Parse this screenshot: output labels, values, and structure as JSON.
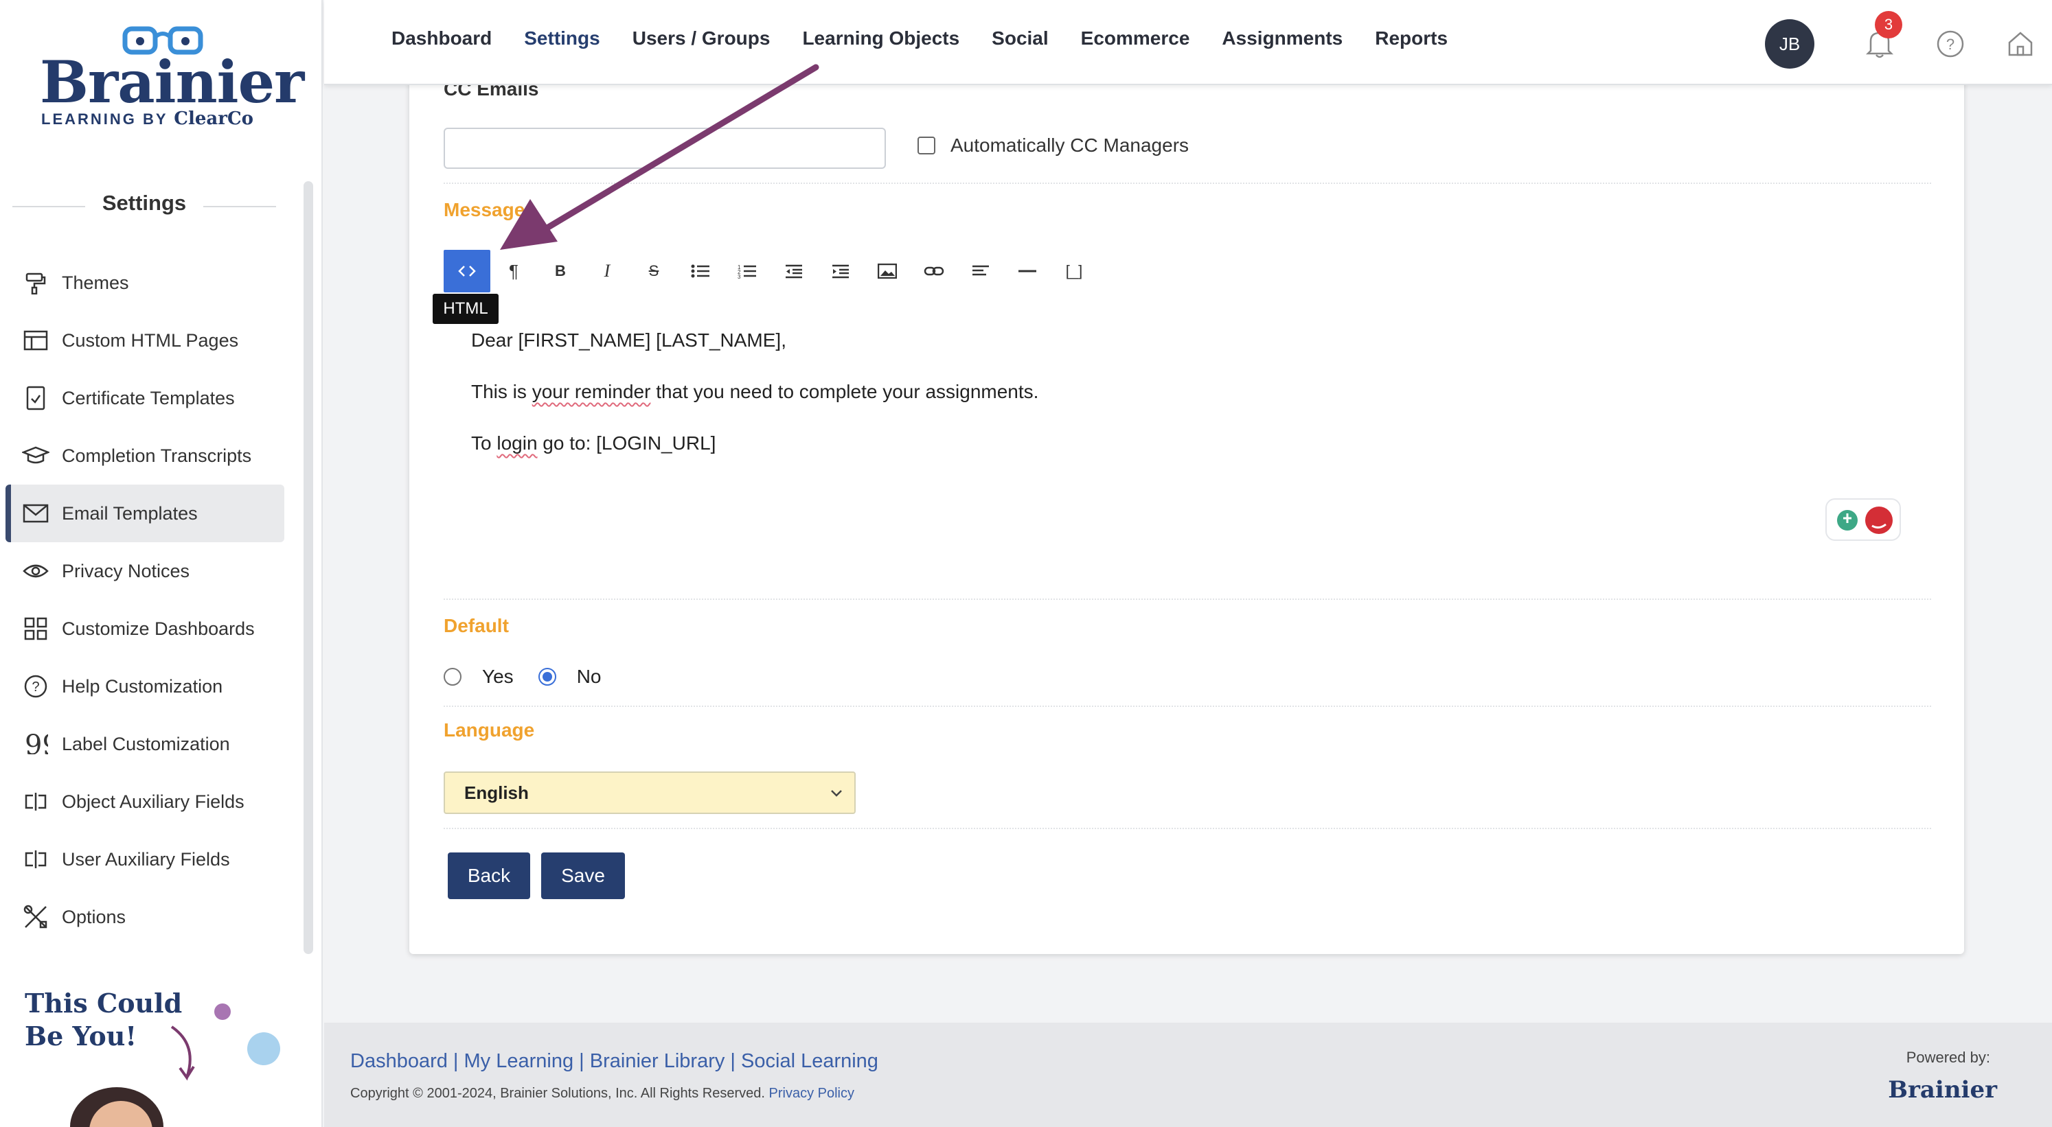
{
  "brand": {
    "name": "Brainier",
    "tagline_prefix": "LEARNING BY",
    "tagline_brand": "ClearCo"
  },
  "sidebar": {
    "heading": "Settings",
    "items": [
      {
        "label": "Themes",
        "icon": "paint-roller-icon"
      },
      {
        "label": "Custom HTML Pages",
        "icon": "layout-icon"
      },
      {
        "label": "Certificate Templates",
        "icon": "certificate-icon"
      },
      {
        "label": "Completion Transcripts",
        "icon": "graduation-cap-icon"
      },
      {
        "label": "Email Templates",
        "icon": "envelope-icon",
        "active": true
      },
      {
        "label": "Privacy Notices",
        "icon": "eye-icon"
      },
      {
        "label": "Customize Dashboards",
        "icon": "grid-icon"
      },
      {
        "label": "Help Customization",
        "icon": "question-circle-icon"
      },
      {
        "label": "Label Customization",
        "icon": "quote-icon"
      },
      {
        "label": "Object Auxiliary Fields",
        "icon": "field-icon"
      },
      {
        "label": "User Auxiliary Fields",
        "icon": "field-icon"
      },
      {
        "label": "Options",
        "icon": "tools-icon"
      }
    ],
    "promo_line1": "This Could",
    "promo_line2": "Be You!"
  },
  "topnav": {
    "links": [
      "Dashboard",
      "Settings",
      "Users / Groups",
      "Learning Objects",
      "Social",
      "Ecommerce",
      "Assignments",
      "Reports"
    ],
    "active": "Settings",
    "avatar_initials": "JB",
    "notification_count": "3"
  },
  "form": {
    "cc_label": "CC Emails",
    "cc_value": "",
    "auto_cc_label": "Automatically CC Managers",
    "message_label": "Message",
    "toolbar_tooltip": "HTML",
    "toolbar": [
      "<>",
      "¶",
      "B",
      "I",
      "S",
      "ul",
      "ol",
      "outdent",
      "indent",
      "image",
      "link",
      "align",
      "hr",
      "[_]"
    ],
    "editor_line1": "Dear [FIRST_NAME] [LAST_NAME],",
    "editor_line2_a": "This is ",
    "editor_line2_b": "your reminder",
    "editor_line2_c": " that you need to complete your assignments.",
    "editor_line3_a": "To ",
    "editor_line3_b": "login",
    "editor_line3_c": " go to: [LOGIN_URL]",
    "default_label": "Default",
    "default_yes": "Yes",
    "default_no": "No",
    "default_selected": "No",
    "language_label": "Language",
    "language_value": "English",
    "back_label": "Back",
    "save_label": "Save"
  },
  "footer": {
    "links": "Dashboard | My Learning | Brainier Library | Social Learning",
    "copyright": "Copyright © 2001-2024, Brainier Solutions, Inc. All Rights Reserved.",
    "privacy": "Privacy Policy",
    "powered_by": "Powered by:",
    "powered_logo": "Brainier"
  },
  "colors": {
    "brand": "#243b6b",
    "accent": "#f0a22e",
    "primary_button": "#263e6f",
    "active_tool": "#3a6fd8",
    "arrow": "#7b3a6e"
  }
}
